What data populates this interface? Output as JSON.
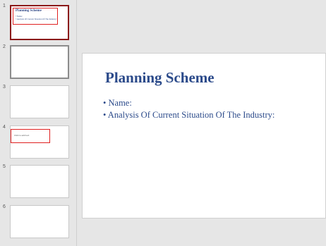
{
  "thumbnails": [
    {
      "number": "1",
      "title": "Planning Scheme",
      "bullets": [
        "• Name:",
        "• Analysis Of Current Situation Of The Industry:"
      ]
    },
    {
      "number": "2"
    },
    {
      "number": "3"
    },
    {
      "number": "4",
      "text": "Click to add text"
    },
    {
      "number": "5"
    },
    {
      "number": "6"
    }
  ],
  "slide": {
    "title": "Planning Scheme",
    "bullets": [
      "• Name:",
      "• Analysis Of Current Situation Of The Industry:"
    ]
  },
  "colors": {
    "title": "#2b4a8a",
    "selected_border": "#8b1a1a",
    "highlight_box": "#e02020"
  }
}
